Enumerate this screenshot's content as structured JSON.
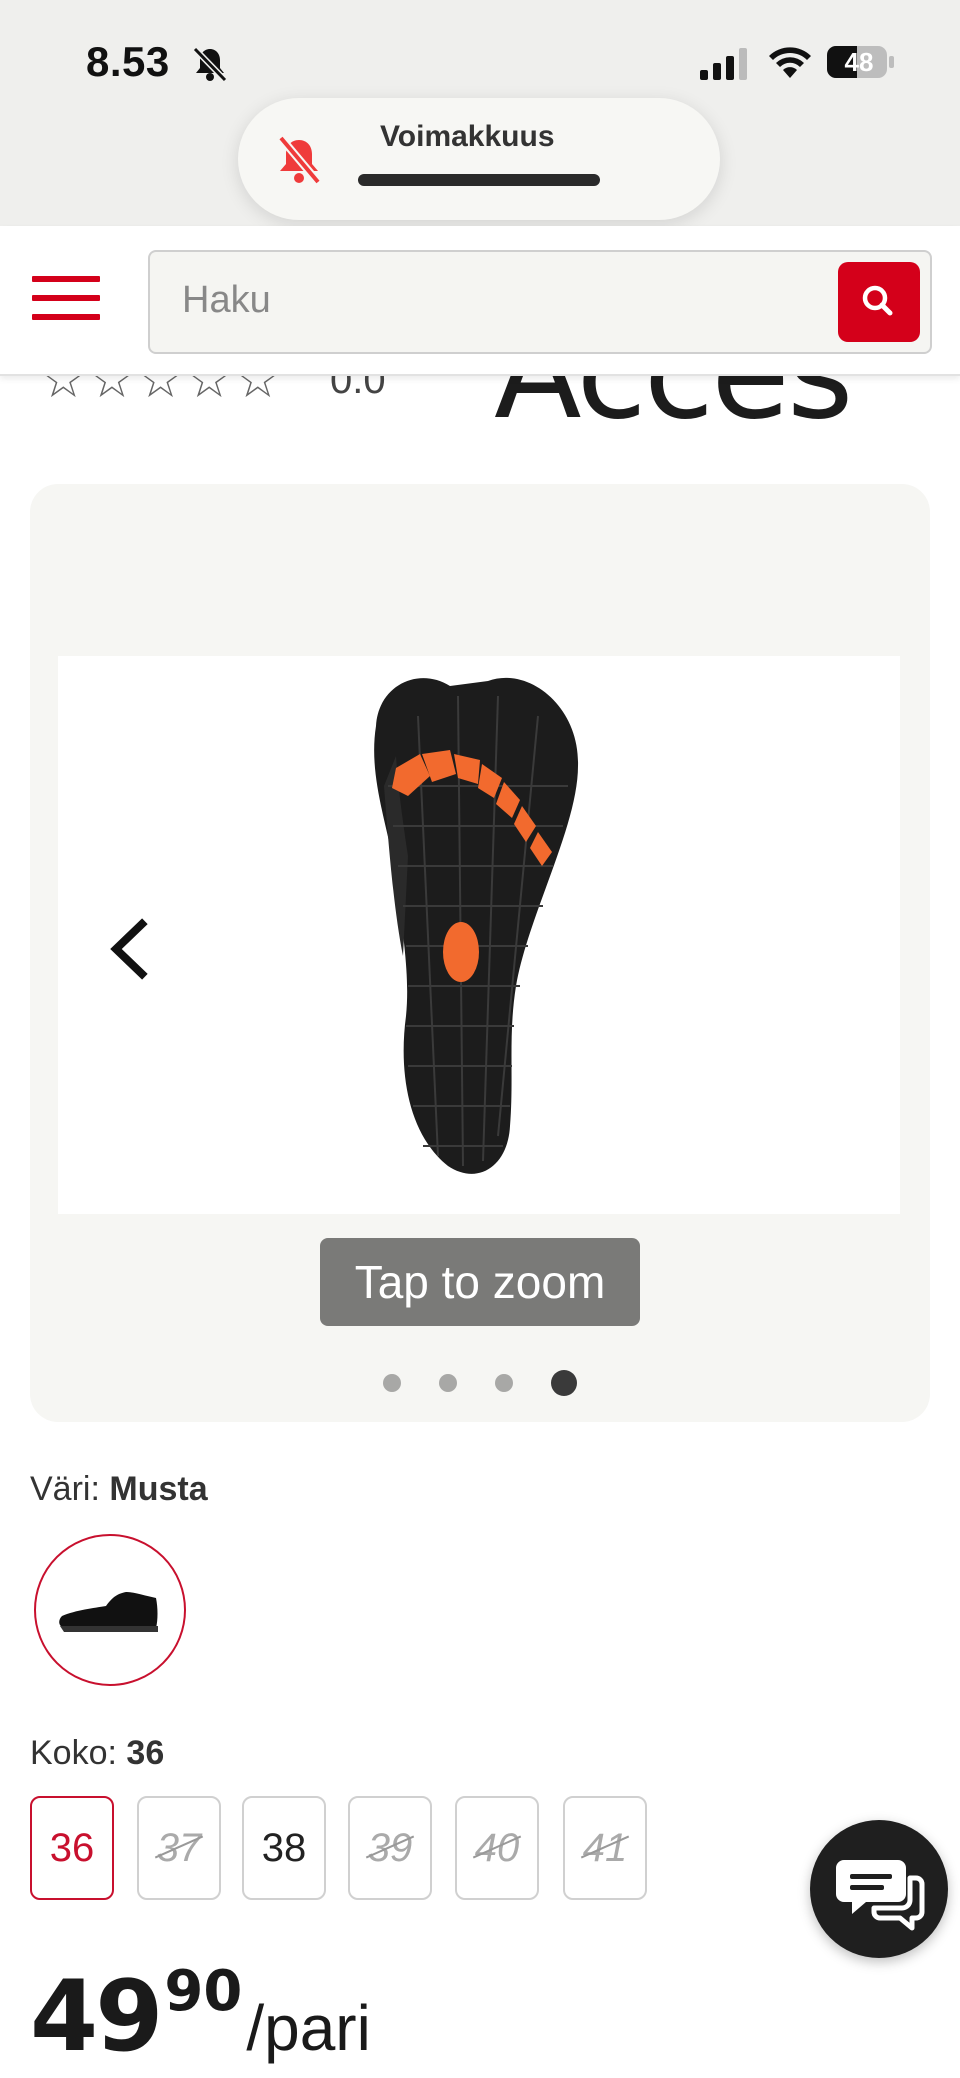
{
  "status_bar": {
    "time": "8.53",
    "battery": "48"
  },
  "volume_hud": {
    "label": "Voimakkuus"
  },
  "header": {
    "search_placeholder": "Haku"
  },
  "product": {
    "stars": [
      "☆",
      "☆",
      "☆",
      "☆",
      "☆"
    ],
    "rating_value": "0.0",
    "brand_logo": "Acces"
  },
  "gallery": {
    "zoom_hint": "Tap to zoom",
    "image_count": 4,
    "active_index": 3
  },
  "color": {
    "label": "Väri:",
    "value": "Musta"
  },
  "size": {
    "label": "Koko:",
    "value": "36",
    "options": [
      {
        "label": "36",
        "state": "selected"
      },
      {
        "label": "37",
        "state": "unavailable"
      },
      {
        "label": "38",
        "state": "available"
      },
      {
        "label": "39",
        "state": "unavailable"
      },
      {
        "label": "40",
        "state": "unavailable"
      },
      {
        "label": "41",
        "state": "unavailable"
      }
    ]
  },
  "price": {
    "main": "49",
    "cents": "90",
    "unit": "/pari"
  },
  "colors": {
    "accent": "#d4001a",
    "sole_orange": "#f26a2e"
  }
}
